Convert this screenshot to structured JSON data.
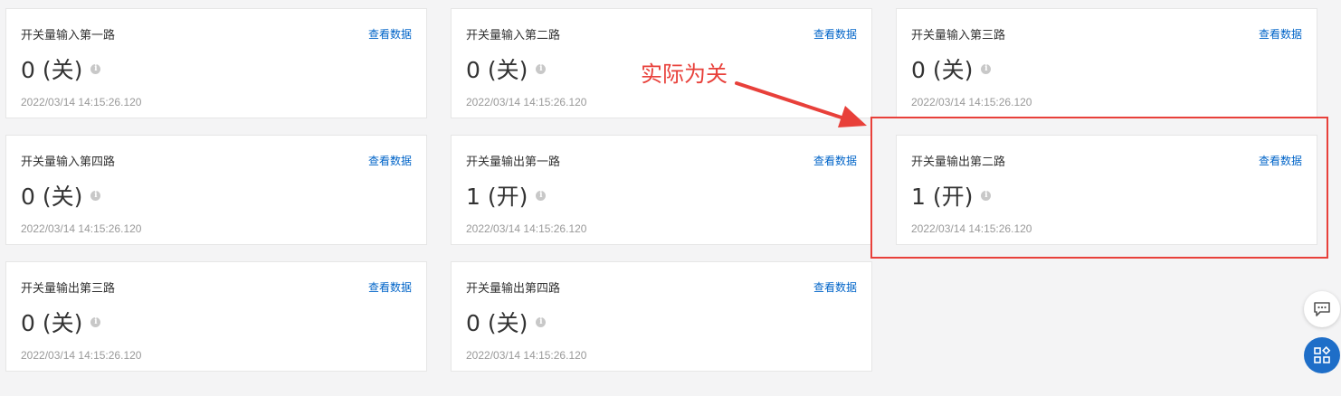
{
  "link_label": "查看数据",
  "annotation": "实际为关",
  "colors": {
    "link": "#0064c8",
    "highlight": "#e8403a",
    "float_primary": "#1e6ec8"
  },
  "cards": [
    {
      "title": "开关量输入第一路",
      "value": "0 (关)",
      "time": "2022/03/14 14:15:26.120"
    },
    {
      "title": "开关量输入第二路",
      "value": "0 (关)",
      "time": "2022/03/14 14:15:26.120"
    },
    {
      "title": "开关量输入第三路",
      "value": "0 (关)",
      "time": "2022/03/14 14:15:26.120"
    },
    {
      "title": "开关量输入第四路",
      "value": "0 (关)",
      "time": "2022/03/14 14:15:26.120"
    },
    {
      "title": "开关量输出第一路",
      "value": "1 (开)",
      "time": "2022/03/14 14:15:26.120"
    },
    {
      "title": "开关量输出第二路",
      "value": "1 (开)",
      "time": "2022/03/14 14:15:26.120"
    },
    {
      "title": "开关量输出第三路",
      "value": "0 (关)",
      "time": "2022/03/14 14:15:26.120"
    },
    {
      "title": "开关量输出第四路",
      "value": "0 (关)",
      "time": "2022/03/14 14:15:26.120"
    }
  ],
  "icons": {
    "info": "info-icon",
    "chat": "chat-icon",
    "apps": "apps-icon"
  }
}
